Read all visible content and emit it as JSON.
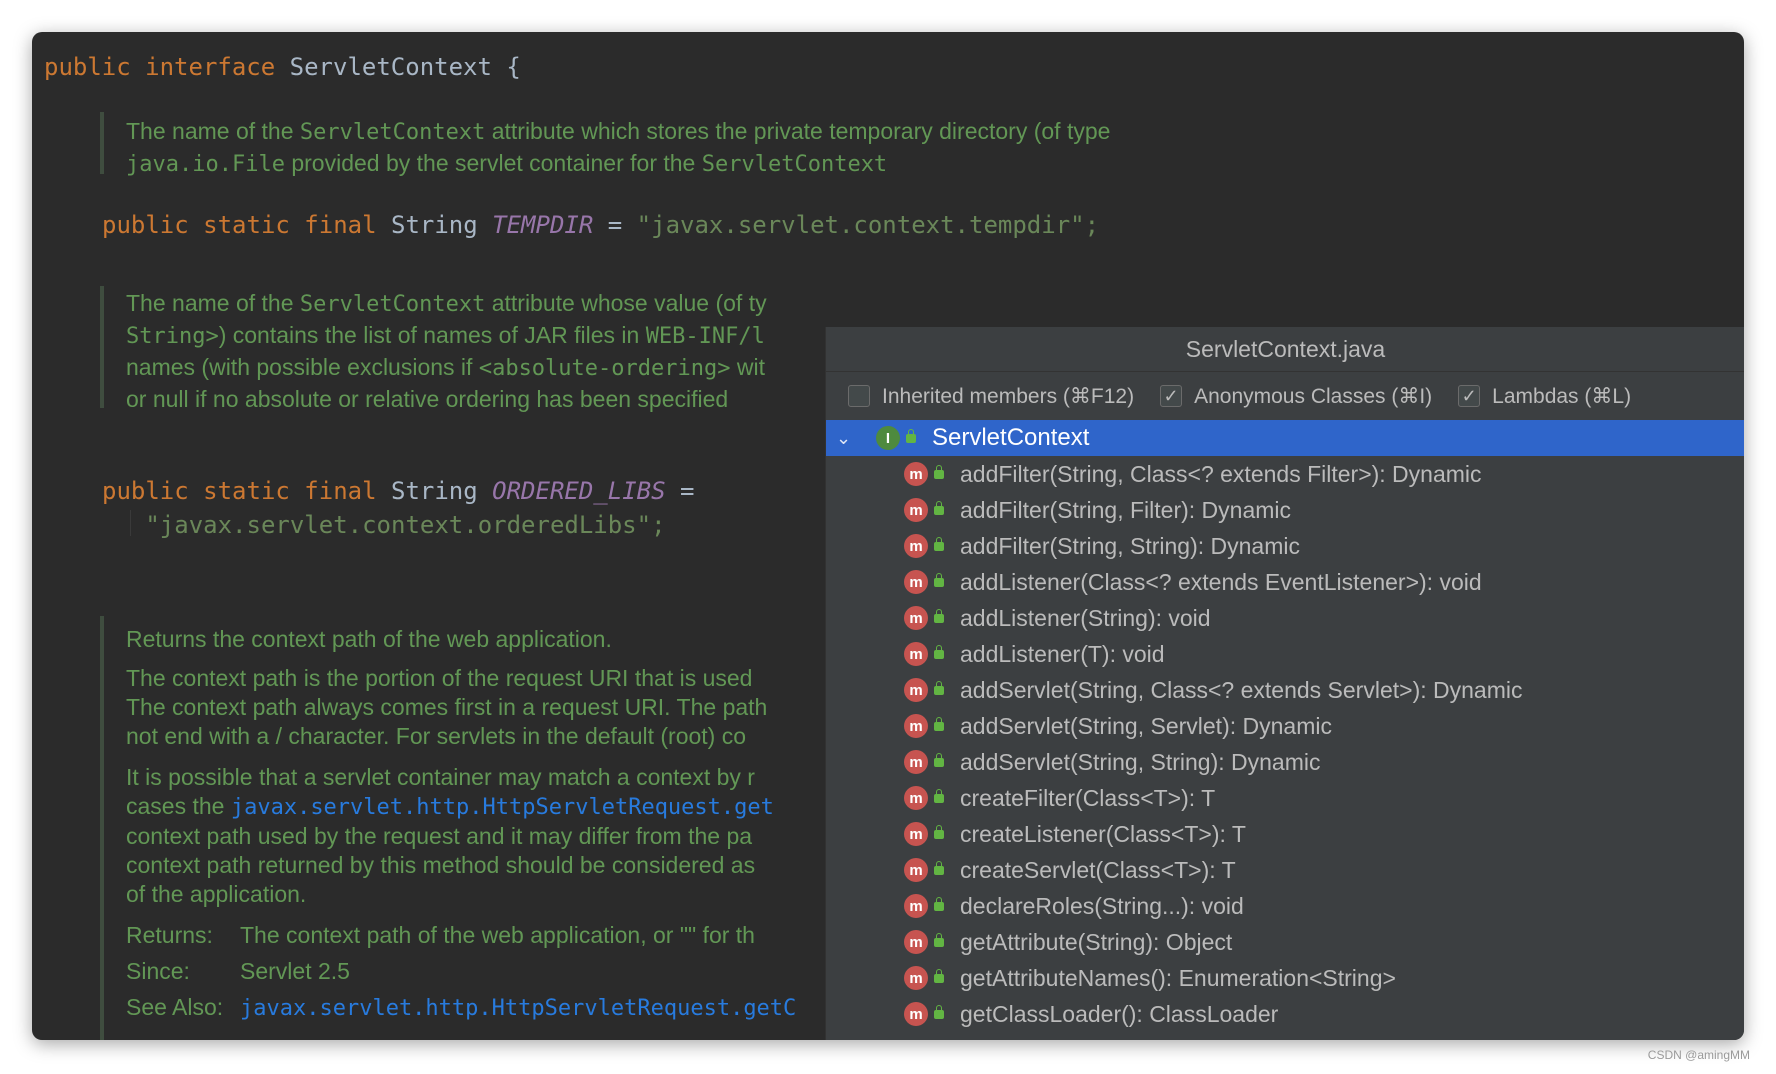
{
  "editor": {
    "decl": {
      "kw1": "public",
      "kw2": "interface",
      "name": "ServletContext",
      "brace": "{"
    },
    "doc1": [
      {
        "t": "The name of the ",
        "m": "ServletContext",
        "t2": " attribute which stores the private temporary directory (of type"
      },
      {
        "m": "java.io.File",
        "t2": " provided by the servlet container for the ",
        "m2": "ServletContext"
      }
    ],
    "field1": {
      "mods": "public static final",
      "type": "String",
      "name": "TEMPDIR",
      "eq": "=",
      "value": "\"javax.servlet.context.tempdir\";"
    },
    "doc2": [
      {
        "t": "The name of the ",
        "m": "ServletContext",
        "t2": " attribute whose value (of ty"
      },
      {
        "m": "String>",
        "t2": ") contains the list of names of JAR files in ",
        "m2": "WEB-INF/l"
      },
      {
        "t": "names (with possible exclusions if ",
        "m": "<absolute-ordering>",
        "t2": " wit"
      },
      {
        "t": "or null if no absolute or relative ordering has been specified"
      }
    ],
    "field2": {
      "mods": "public static final",
      "type": "String",
      "name": "ORDERED_LIBS",
      "eq": "=",
      "value": "\"javax.servlet.context.orderedLibs\";"
    },
    "doc3": {
      "p1": "Returns the context path of the web application.",
      "p2": [
        "The context path is the portion of the request URI that is used",
        "The context path always comes first in a request URI. The path",
        "not end with a / character. For servlets in the default (root) co"
      ],
      "p3a": "It is possible that a servlet container may match a context by r",
      "p3b_pre": "cases the ",
      "p3b_link": "javax.servlet.http.HttpServletRequest.get",
      "p3c": [
        "context path used by the request and it may differ from the pa",
        "context path returned by this method should be considered as",
        "of the application."
      ],
      "returns_label": "Returns:",
      "returns_text": "The context path of the web application, or \"\" for th",
      "since_label": "Since:",
      "since_text": "Servlet 2.5",
      "see_label": "See Also:",
      "see_link": "javax.servlet.http.HttpServletRequest.getC"
    }
  },
  "popup": {
    "title": "ServletContext.java",
    "options": [
      {
        "label": "Inherited members (⌘F12)",
        "checked": false
      },
      {
        "label": "Anonymous Classes (⌘I)",
        "checked": true
      },
      {
        "label": "Lambdas (⌘L)",
        "checked": true
      }
    ],
    "root": {
      "label": "ServletContext",
      "badge": "I"
    },
    "members": [
      "addFilter(String, Class<? extends Filter>): Dynamic",
      "addFilter(String, Filter): Dynamic",
      "addFilter(String, String): Dynamic",
      "addListener(Class<? extends EventListener>): void",
      "addListener(String): void",
      "addListener(T): void",
      "addServlet(String, Class<? extends Servlet>): Dynamic",
      "addServlet(String, Servlet): Dynamic",
      "addServlet(String, String): Dynamic",
      "createFilter(Class<T>): T",
      "createListener(Class<T>): T",
      "createServlet(Class<T>): T",
      "declareRoles(String...): void",
      "getAttribute(String): Object",
      "getAttributeNames(): Enumeration<String>",
      "getClassLoader(): ClassLoader"
    ],
    "method_badge": "m"
  },
  "watermark": "CSDN @amingMM"
}
